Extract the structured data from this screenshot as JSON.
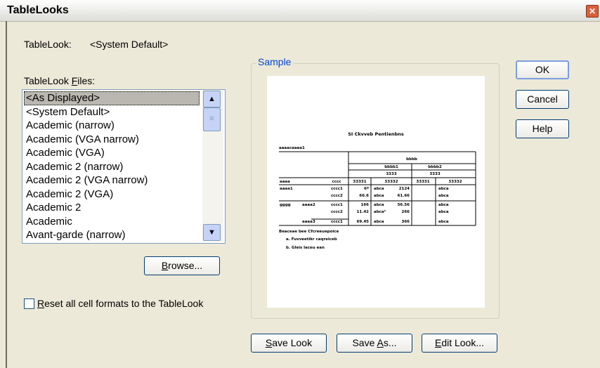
{
  "window": {
    "title": "TableLooks"
  },
  "tablelook": {
    "label": "TableLook:",
    "value": "<System Default>"
  },
  "files": {
    "label_prefix": "TableLook ",
    "label_key": "F",
    "label_rest": "iles:",
    "items": [
      "<As Displayed>",
      "<System Default>",
      "Academic (narrow)",
      "Academic (VGA narrow)",
      "Academic (VGA)",
      "Academic 2 (narrow)",
      "Academic 2 (VGA narrow)",
      "Academic 2 (VGA)",
      "Academic 2",
      "Academic",
      "Avant-garde (narrow)"
    ],
    "selected_index": 0
  },
  "browse": {
    "key": "B",
    "rest": "rowse..."
  },
  "reset": {
    "key": "R",
    "rest": "eset all cell formats to the TableLook",
    "checked": false
  },
  "sample": {
    "label": "Sample",
    "title": "SI Ckvveb Pentienbns",
    "corner": "aaaacaaaa1",
    "header_bbbb": "bbbb",
    "header_b1": "bbbb1",
    "header_b2": "bbbb2",
    "header_cccc": "3333",
    "col_labels": [
      "aaaa",
      "cccc",
      "33331",
      "33332",
      "33331",
      "33332"
    ],
    "rows": [
      [
        "aaaa1",
        "",
        "cccc1",
        "6ª",
        "abca",
        "2124",
        "abca"
      ],
      [
        "",
        "",
        "cccc2",
        "66.6",
        "abca",
        "61.66",
        "abca"
      ],
      [
        "gggg",
        "aaaa2",
        "cccc1",
        "166",
        "abca",
        "56.56",
        "abca"
      ],
      [
        "",
        "",
        "cccc2",
        "11.42",
        "abcaᵇ",
        "266",
        "abca"
      ],
      [
        "",
        "aaaa3",
        "cccc1",
        "69.45",
        "abca",
        "366",
        "abca"
      ]
    ],
    "footnote_title": "Beaceae bee Cfcreeuepoice",
    "footnotes": [
      "a. Fuvveetikr caqreiceb",
      "b. Gleis laceu ean"
    ]
  },
  "buttons": {
    "ok": "OK",
    "cancel": "Cancel",
    "help": "Help",
    "save_look": {
      "key": "S",
      "rest": "ave Look"
    },
    "save_as": {
      "pre": "Save ",
      "key": "A",
      "rest": "s..."
    },
    "edit_look": {
      "key": "E",
      "rest": "dit Look..."
    }
  }
}
